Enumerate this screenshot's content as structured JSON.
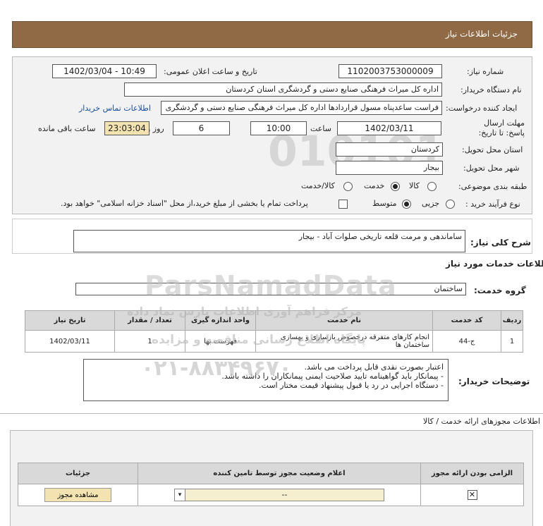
{
  "header": {
    "title": "جزئیات اطلاعات نیاز"
  },
  "fields": {
    "need_number_label": "شماره نیاز:",
    "need_number": "1102003753000009",
    "announce_label": "تاریخ و ساعت اعلان عمومی:",
    "announce_value": "1402/03/04 - 10:49",
    "buyer_org_label": "نام دستگاه خریدار:",
    "buyer_org": "اداره کل میراث فرهنگی  صنایع دستی و گردشگری استان کردستان",
    "creator_label": "ایجاد کننده درخواست:",
    "creator": "فراست ساعدپناه مسول قراردادها اداره کل میراث فرهنگی  صنایع دستی و گردشگری",
    "contact_link": "اطلاعات تماس خریدار",
    "deadline_label": "مهلت ارسال پاسخ: تا تاریخ:",
    "deadline_date": "1402/03/11",
    "time_label": "ساعت",
    "deadline_time": "10:00",
    "days_value": "6",
    "days_label": "روز و",
    "remaining_time": "23:03:04",
    "remaining_label": "ساعت باقی مانده",
    "province_label": "استان محل تحویل:",
    "province": "کردستان",
    "city_label": "شهر محل تحویل:",
    "city": "بیجار",
    "category_label": "طبقه بندی موضوعی:",
    "category_options": [
      "کالا",
      "خدمت",
      "کالا/خدمت"
    ],
    "category_selected": "خدمت",
    "purchase_label": "نوع فرآیند خرید :",
    "purchase_options": [
      "جزیی",
      "متوسط"
    ],
    "purchase_selected": "متوسط",
    "treasury_note": "پرداخت تمام یا بخشی از مبلغ خرید،از محل \"اسناد خزانه اسلامی\" خواهد بود."
  },
  "summary": {
    "label": "شرح کلی نیاز:",
    "value": "ساماندهی و مرمت قلعه تاریخی صلوات آباد - بیجار"
  },
  "services_section": {
    "title": "اطلاعات خدمات مورد نیاز",
    "group_label": "گروه خدمت:",
    "group_value": "ساختمان",
    "columns": [
      "ردیف",
      "کد خدمت",
      "نام خدمت",
      "واحد اندازه گیری",
      "تعداد / مقدار",
      "تاریخ نیاز"
    ],
    "rows": [
      {
        "index": "1",
        "code": "ج-44",
        "name": "انجام کارهای متفرقه درخصوص بازسازی و بهسازی ساختمان ها",
        "unit": "فهرست بها",
        "qty": "1",
        "date": "1402/03/11"
      }
    ]
  },
  "buyer_notes": {
    "label": "توضیحات خریدار:",
    "lines": [
      "اعتبار بصورت نقدی قابل پرداخت می باشد.",
      "- پیمانکار باید گواهینامه تایید صلاحیت ایمنی پیمانکاران را داشته باشد.",
      "- دستگاه اجرایی در رد یا قبول پیشنهاد قیمت مختار است."
    ]
  },
  "permits": {
    "title": "اطلاعات مجوزهای ارائه خدمت / کالا",
    "columns": [
      "الزامی بودن ارائه مجوز",
      "اعلام وضعیت مجوز توسط تامین کننده",
      "جزئیات"
    ],
    "select_value": "--",
    "view_button": "مشاهده مجوز"
  },
  "watermark": {
    "line1": "ParsNamadData",
    "line2": "مرکز فراهم آوری اطلاعات پارس نماد داده",
    "line3": "پایگاه اطلاع رسانی مناقصه و مزایده",
    "phone": "۰۲۱-۸۸۳۴۹۶۷۰"
  }
}
